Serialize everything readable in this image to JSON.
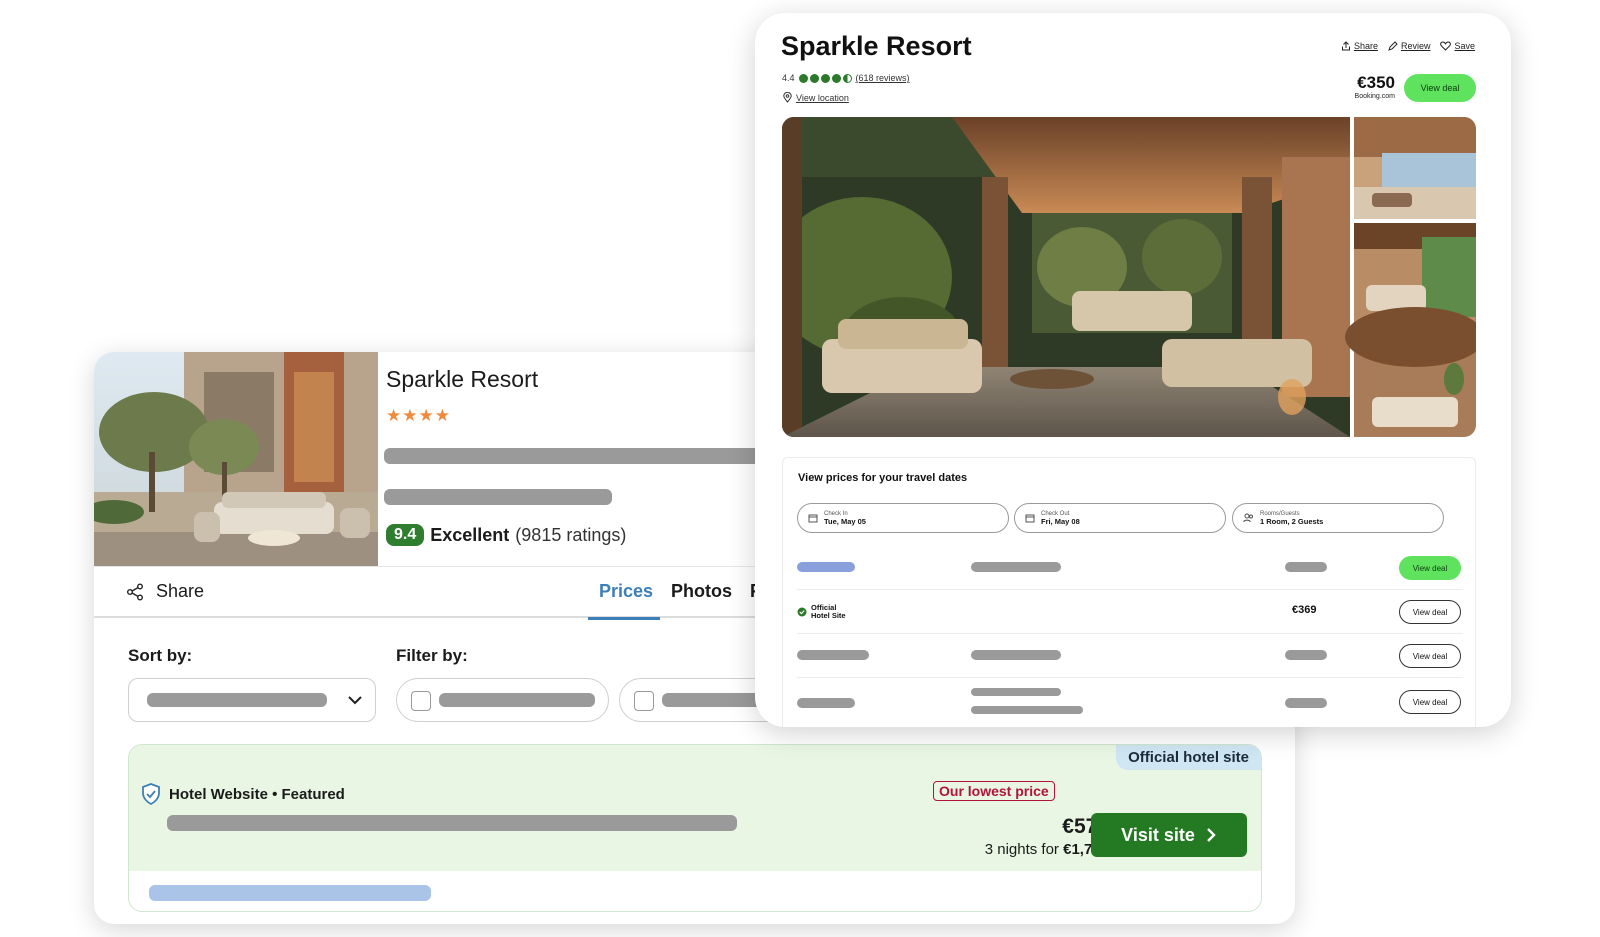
{
  "back_card": {
    "title": "Sparkle Resort",
    "stars": "★★★★",
    "rating_score": "9.4",
    "rating_word": "Excellent",
    "rating_count": "(9815 ratings)",
    "share_label": "Share",
    "tabs": [
      "Prices",
      "Photos",
      "F"
    ],
    "sort_label": "Sort by:",
    "filter_label": "Filter by:",
    "featured": {
      "official_tag": "Official hotel site",
      "site_label": "Hotel Website • Featured",
      "lowest_price_label": "Our lowest price",
      "price": "€576",
      "nights_prefix": "3 nights for ",
      "nights_total": "€1,727",
      "visit_button": "Visit site"
    }
  },
  "front_card": {
    "title": "Sparkle Resort",
    "actions": [
      "Share",
      "Review",
      "Save"
    ],
    "rating_value": "4.4",
    "reviews_link": "(618 reviews)",
    "location_link": "View location",
    "price": "€350",
    "price_source": "Booking.com",
    "view_deal_label": "View deal",
    "prices_panel": {
      "title": "View prices for your travel dates",
      "check_in_label": "Check In",
      "check_in_value": "Tue, May 05",
      "check_out_label": "Check Out",
      "check_out_value": "Fri, May 08",
      "rooms_label": "Rooms/Guests",
      "rooms_value": "1 Room, 2 Guests",
      "official_site_line1": "Official",
      "official_site_line2": "Hotel Site",
      "official_price": "€369",
      "row_button": "View deal"
    }
  },
  "colors": {
    "accent_green": "#237a23",
    "deal_green": "#5fe35f",
    "tab_blue": "#3d7fb8",
    "lowest_price_red": "#b0143c",
    "star_orange": "#f08a3c"
  },
  "icons": [
    "share-icon",
    "chevron-down-icon",
    "shield-check-icon",
    "chevron-right-icon",
    "review-pencil-icon",
    "heart-icon",
    "location-pin-icon",
    "calendar-icon",
    "guests-icon",
    "verified-check-icon"
  ]
}
